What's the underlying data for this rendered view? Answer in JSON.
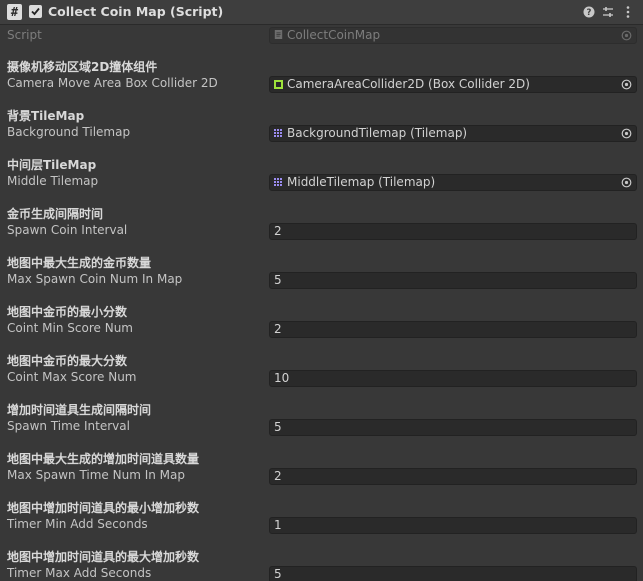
{
  "header": {
    "script_badge": "#",
    "title": "Collect Coin Map (Script)",
    "enabled": true,
    "icons": [
      "help-icon",
      "preset-icon",
      "more-options-icon"
    ]
  },
  "script_row": {
    "label": "Script",
    "value": "CollectCoinMap"
  },
  "properties": [
    {
      "label_cn": "摄像机移动区域2D撞体组件",
      "label": "Camera Move Area Box Collider 2D",
      "kind": "object",
      "icon": "box-collider-icon",
      "value": "CameraAreaCollider2D (Box Collider 2D)"
    },
    {
      "label_cn": "背景TileMap",
      "label": "Background Tilemap",
      "kind": "object",
      "icon": "tilemap-icon",
      "value": "BackgroundTilemap (Tilemap)"
    },
    {
      "label_cn": "中间层TileMap",
      "label": "Middle Tilemap",
      "kind": "object",
      "icon": "tilemap-icon",
      "value": "MiddleTilemap (Tilemap)"
    },
    {
      "label_cn": "金币生成间隔时间",
      "label": "Spawn Coin Interval",
      "kind": "number",
      "value": "2"
    },
    {
      "label_cn": "地图中最大生成的金币数量",
      "label": "Max Spawn Coin Num In Map",
      "kind": "number",
      "value": "5"
    },
    {
      "label_cn": "地图中金币的最小分数",
      "label": "Coint Min Score Num",
      "kind": "number",
      "value": "2"
    },
    {
      "label_cn": "地图中金币的最大分数",
      "label": "Coint Max Score Num",
      "kind": "number",
      "value": "10"
    },
    {
      "label_cn": "增加时间道具生成间隔时间",
      "label": "Spawn Time Interval",
      "kind": "number",
      "value": "5"
    },
    {
      "label_cn": "地图中最大生成的增加时间道具数量",
      "label": "Max Spawn Time Num In Map",
      "kind": "number",
      "value": "2"
    },
    {
      "label_cn": "地图中增加时间道具的最小增加秒数",
      "label": "Timer Min Add Seconds",
      "kind": "number",
      "value": "1"
    },
    {
      "label_cn": "地图中增加时间道具的最大增加秒数",
      "label": "Timer Max Add Seconds",
      "kind": "number",
      "value": "5"
    }
  ],
  "colors": {
    "background": "#383838",
    "field": "#2a2a2a",
    "collider_icon": "#9fe33b",
    "tilemap_icon": "#9b8cf0"
  }
}
